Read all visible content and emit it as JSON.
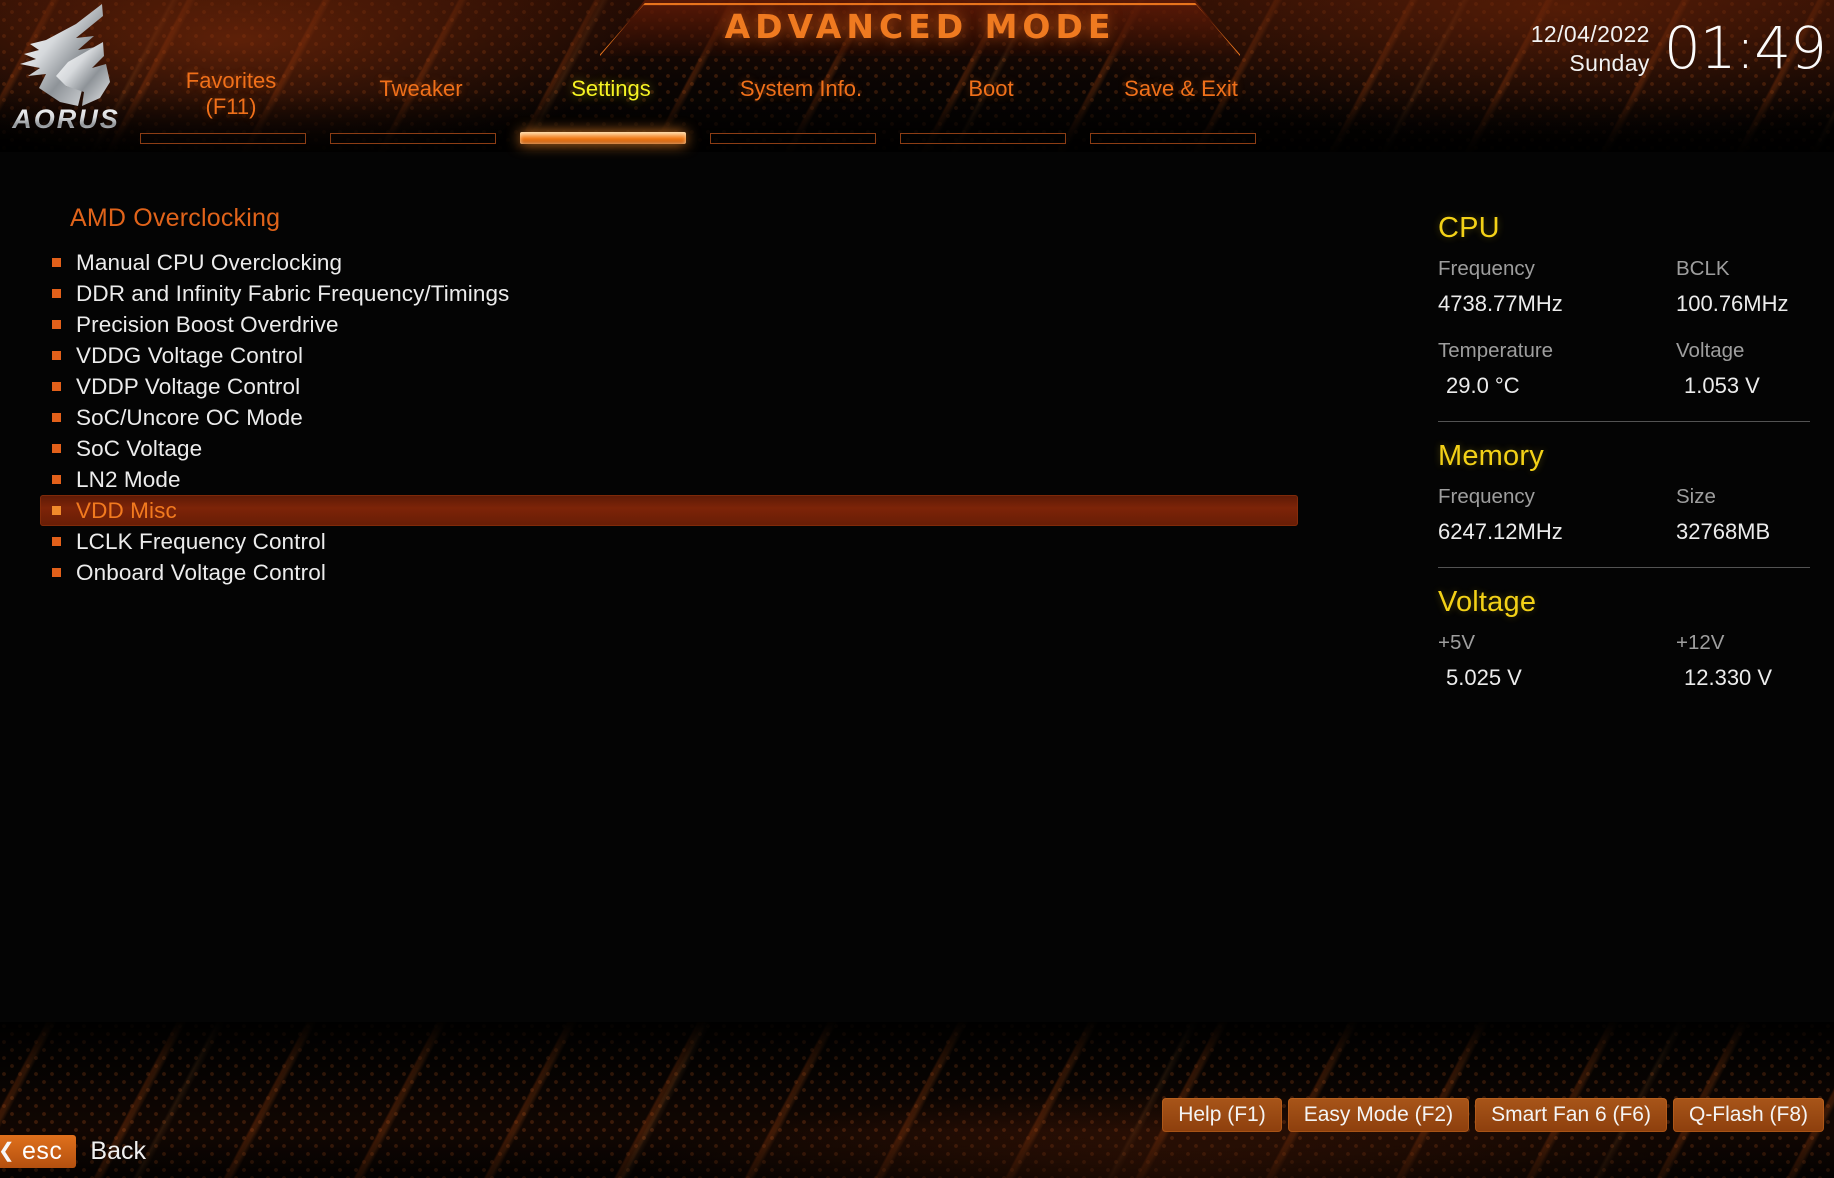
{
  "header": {
    "mode_title": "ADVANCED MODE",
    "brand": "AORUS",
    "date": "12/04/2022",
    "weekday": "Sunday",
    "time": "01:49"
  },
  "nav": {
    "items": [
      {
        "label": "Favorites\n(F11)",
        "active": false
      },
      {
        "label": "Tweaker",
        "active": false
      },
      {
        "label": "Settings",
        "active": true
      },
      {
        "label": "System Info.",
        "active": false
      },
      {
        "label": "Boot",
        "active": false
      },
      {
        "label": "Save & Exit",
        "active": false
      }
    ]
  },
  "main": {
    "page_title": "AMD Overclocking",
    "menu_items": [
      {
        "label": "Manual CPU Overclocking",
        "selected": false
      },
      {
        "label": "DDR and Infinity Fabric Frequency/Timings",
        "selected": false
      },
      {
        "label": "Precision Boost Overdrive",
        "selected": false
      },
      {
        "label": "VDDG Voltage Control",
        "selected": false
      },
      {
        "label": "VDDP Voltage Control",
        "selected": false
      },
      {
        "label": "SoC/Uncore OC Mode",
        "selected": false
      },
      {
        "label": "SoC Voltage",
        "selected": false
      },
      {
        "label": "LN2 Mode",
        "selected": false
      },
      {
        "label": "VDD Misc",
        "selected": true
      },
      {
        "label": "LCLK Frequency Control",
        "selected": false
      },
      {
        "label": "Onboard Voltage Control",
        "selected": false
      }
    ],
    "help_text": "VDD Misc"
  },
  "sysinfo": {
    "sections": [
      {
        "title": "CPU",
        "fields": [
          {
            "label": "Frequency",
            "value": "4738.77MHz"
          },
          {
            "label": "BCLK",
            "value": "100.76MHz"
          },
          {
            "label": "Temperature",
            "value": "29.0 °C"
          },
          {
            "label": "Voltage",
            "value": "1.053 V"
          }
        ]
      },
      {
        "title": "Memory",
        "fields": [
          {
            "label": "Frequency",
            "value": "6247.12MHz"
          },
          {
            "label": "Size",
            "value": "32768MB"
          }
        ]
      },
      {
        "title": "Voltage",
        "fields": [
          {
            "label": "+5V",
            "value": "5.025 V"
          },
          {
            "label": "+12V",
            "value": "12.330 V"
          }
        ]
      }
    ]
  },
  "footer": {
    "function_keys": [
      {
        "label": "Help (F1)"
      },
      {
        "label": "Easy Mode (F2)"
      },
      {
        "label": "Smart Fan 6 (F6)"
      },
      {
        "label": "Q-Flash (F8)"
      }
    ],
    "esc_key": "esc",
    "back_label": "Back"
  },
  "colors": {
    "accent_orange": "#f0701a",
    "accent_yellow": "#f5f323",
    "section_title": "#f3d117",
    "selected_row_bg": "#7d2408",
    "text_primary": "#ececec",
    "text_muted": "#9e9e9e"
  }
}
